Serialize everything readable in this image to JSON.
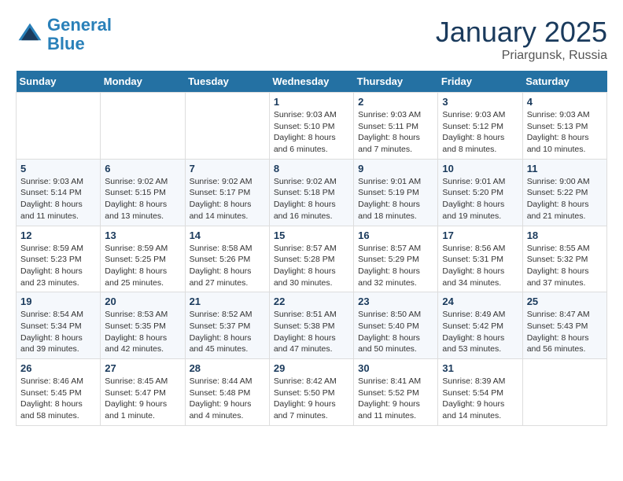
{
  "logo": {
    "line1": "General",
    "line2": "Blue"
  },
  "title": "January 2025",
  "location": "Priargunsk, Russia",
  "weekdays": [
    "Sunday",
    "Monday",
    "Tuesday",
    "Wednesday",
    "Thursday",
    "Friday",
    "Saturday"
  ],
  "weeks": [
    [
      {
        "day": "",
        "detail": ""
      },
      {
        "day": "",
        "detail": ""
      },
      {
        "day": "",
        "detail": ""
      },
      {
        "day": "1",
        "detail": "Sunrise: 9:03 AM\nSunset: 5:10 PM\nDaylight: 8 hours and 6 minutes."
      },
      {
        "day": "2",
        "detail": "Sunrise: 9:03 AM\nSunset: 5:11 PM\nDaylight: 8 hours and 7 minutes."
      },
      {
        "day": "3",
        "detail": "Sunrise: 9:03 AM\nSunset: 5:12 PM\nDaylight: 8 hours and 8 minutes."
      },
      {
        "day": "4",
        "detail": "Sunrise: 9:03 AM\nSunset: 5:13 PM\nDaylight: 8 hours and 10 minutes."
      }
    ],
    [
      {
        "day": "5",
        "detail": "Sunrise: 9:03 AM\nSunset: 5:14 PM\nDaylight: 8 hours and 11 minutes."
      },
      {
        "day": "6",
        "detail": "Sunrise: 9:02 AM\nSunset: 5:15 PM\nDaylight: 8 hours and 13 minutes."
      },
      {
        "day": "7",
        "detail": "Sunrise: 9:02 AM\nSunset: 5:17 PM\nDaylight: 8 hours and 14 minutes."
      },
      {
        "day": "8",
        "detail": "Sunrise: 9:02 AM\nSunset: 5:18 PM\nDaylight: 8 hours and 16 minutes."
      },
      {
        "day": "9",
        "detail": "Sunrise: 9:01 AM\nSunset: 5:19 PM\nDaylight: 8 hours and 18 minutes."
      },
      {
        "day": "10",
        "detail": "Sunrise: 9:01 AM\nSunset: 5:20 PM\nDaylight: 8 hours and 19 minutes."
      },
      {
        "day": "11",
        "detail": "Sunrise: 9:00 AM\nSunset: 5:22 PM\nDaylight: 8 hours and 21 minutes."
      }
    ],
    [
      {
        "day": "12",
        "detail": "Sunrise: 8:59 AM\nSunset: 5:23 PM\nDaylight: 8 hours and 23 minutes."
      },
      {
        "day": "13",
        "detail": "Sunrise: 8:59 AM\nSunset: 5:25 PM\nDaylight: 8 hours and 25 minutes."
      },
      {
        "day": "14",
        "detail": "Sunrise: 8:58 AM\nSunset: 5:26 PM\nDaylight: 8 hours and 27 minutes."
      },
      {
        "day": "15",
        "detail": "Sunrise: 8:57 AM\nSunset: 5:28 PM\nDaylight: 8 hours and 30 minutes."
      },
      {
        "day": "16",
        "detail": "Sunrise: 8:57 AM\nSunset: 5:29 PM\nDaylight: 8 hours and 32 minutes."
      },
      {
        "day": "17",
        "detail": "Sunrise: 8:56 AM\nSunset: 5:31 PM\nDaylight: 8 hours and 34 minutes."
      },
      {
        "day": "18",
        "detail": "Sunrise: 8:55 AM\nSunset: 5:32 PM\nDaylight: 8 hours and 37 minutes."
      }
    ],
    [
      {
        "day": "19",
        "detail": "Sunrise: 8:54 AM\nSunset: 5:34 PM\nDaylight: 8 hours and 39 minutes."
      },
      {
        "day": "20",
        "detail": "Sunrise: 8:53 AM\nSunset: 5:35 PM\nDaylight: 8 hours and 42 minutes."
      },
      {
        "day": "21",
        "detail": "Sunrise: 8:52 AM\nSunset: 5:37 PM\nDaylight: 8 hours and 45 minutes."
      },
      {
        "day": "22",
        "detail": "Sunrise: 8:51 AM\nSunset: 5:38 PM\nDaylight: 8 hours and 47 minutes."
      },
      {
        "day": "23",
        "detail": "Sunrise: 8:50 AM\nSunset: 5:40 PM\nDaylight: 8 hours and 50 minutes."
      },
      {
        "day": "24",
        "detail": "Sunrise: 8:49 AM\nSunset: 5:42 PM\nDaylight: 8 hours and 53 minutes."
      },
      {
        "day": "25",
        "detail": "Sunrise: 8:47 AM\nSunset: 5:43 PM\nDaylight: 8 hours and 56 minutes."
      }
    ],
    [
      {
        "day": "26",
        "detail": "Sunrise: 8:46 AM\nSunset: 5:45 PM\nDaylight: 8 hours and 58 minutes."
      },
      {
        "day": "27",
        "detail": "Sunrise: 8:45 AM\nSunset: 5:47 PM\nDaylight: 9 hours and 1 minute."
      },
      {
        "day": "28",
        "detail": "Sunrise: 8:44 AM\nSunset: 5:48 PM\nDaylight: 9 hours and 4 minutes."
      },
      {
        "day": "29",
        "detail": "Sunrise: 8:42 AM\nSunset: 5:50 PM\nDaylight: 9 hours and 7 minutes."
      },
      {
        "day": "30",
        "detail": "Sunrise: 8:41 AM\nSunset: 5:52 PM\nDaylight: 9 hours and 11 minutes."
      },
      {
        "day": "31",
        "detail": "Sunrise: 8:39 AM\nSunset: 5:54 PM\nDaylight: 9 hours and 14 minutes."
      },
      {
        "day": "",
        "detail": ""
      }
    ]
  ]
}
